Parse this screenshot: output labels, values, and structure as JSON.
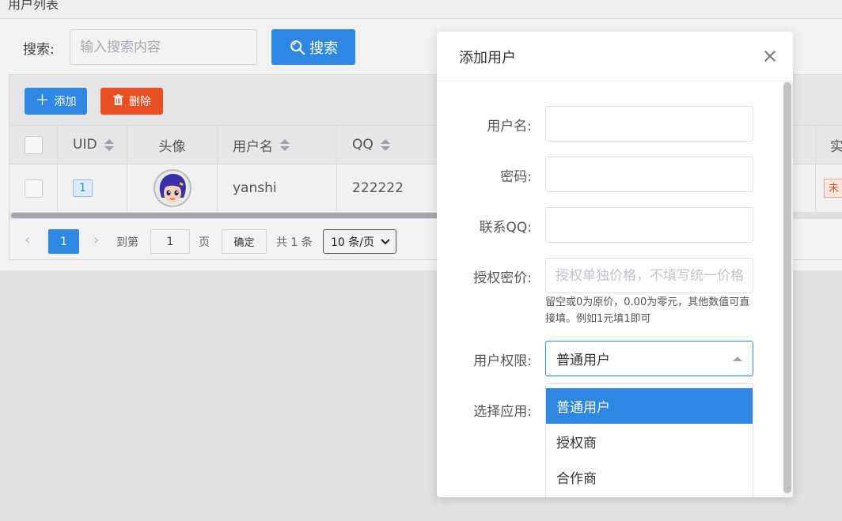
{
  "breadcrumb": "用户列表",
  "search": {
    "label": "搜索:",
    "placeholder": "输入搜索内容",
    "button_label": "搜索"
  },
  "toolbar": {
    "add_label": "添加",
    "delete_label": "删除"
  },
  "table": {
    "columns": [
      "UID",
      "头像",
      "用户名",
      "QQ",
      "实"
    ],
    "rows": [
      {
        "uid": "1",
        "username": "yanshi",
        "qq": "222222",
        "state": "未"
      }
    ]
  },
  "pager": {
    "current_page": "1",
    "goto_prefix": "到第",
    "goto_value": "1",
    "goto_suffix": "页",
    "confirm_label": "确定",
    "total": "共 1 条",
    "page_size": "10 条/页"
  },
  "modal": {
    "title": "添加用户",
    "fields": {
      "username_label": "用户名:",
      "password_label": "密码:",
      "qq_label": "联系QQ:",
      "price_label": "授权密价:",
      "price_placeholder": "授权单独价格，不填写统一价格",
      "price_hint": "留空或0为原价，0.00为零元，其他数值可直接填。例如1元填1即可",
      "role_label": "用户权限:",
      "role_value": "普通用户",
      "app_label": "选择应用:"
    },
    "role_options": [
      "普通用户",
      "授权商",
      "合作商"
    ],
    "selected_role_index": 0
  },
  "colors": {
    "primary": "#2e87e0",
    "danger": "#e8501f"
  }
}
